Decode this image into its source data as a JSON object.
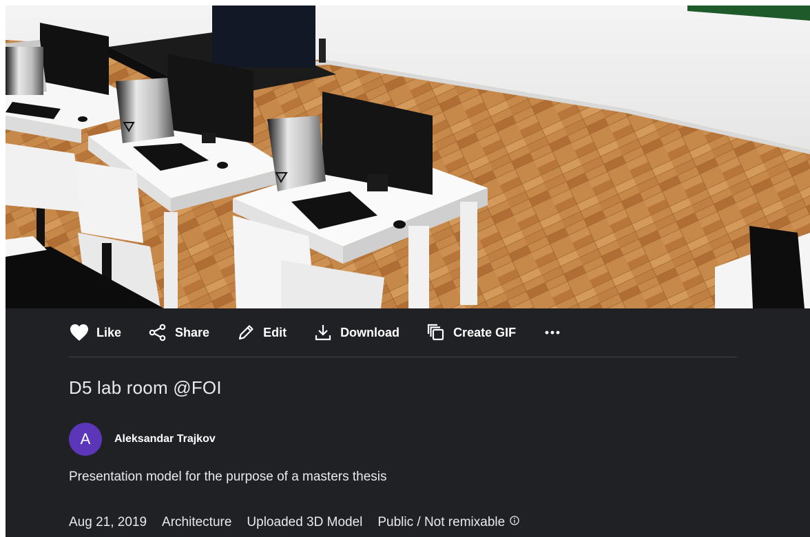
{
  "viewer": {
    "scene_description_icon": "3d-model-view"
  },
  "actions": [
    {
      "label": "Like",
      "icon": "heart-icon"
    },
    {
      "label": "Share",
      "icon": "share-icon"
    },
    {
      "label": "Edit",
      "icon": "pencil-icon"
    },
    {
      "label": "Download",
      "icon": "download-icon"
    },
    {
      "label": "Create GIF",
      "icon": "create-gif-icon"
    },
    {
      "label": "",
      "icon": "more-icon"
    }
  ],
  "model": {
    "title": "D5 lab room @FOI",
    "author": {
      "initial": "A",
      "name": "Aleksandar Trajkov",
      "avatar_color": "#5b36b8"
    },
    "description": "Presentation model for the purpose of a masters thesis",
    "meta": {
      "date": "Aug 21, 2019",
      "category": "Architecture",
      "type": "Uploaded 3D Model",
      "visibility": "Public / Not remixable"
    }
  },
  "colors": {
    "panel_bg": "#202124",
    "text": "#e8eaed",
    "divider": "#3c4043"
  }
}
